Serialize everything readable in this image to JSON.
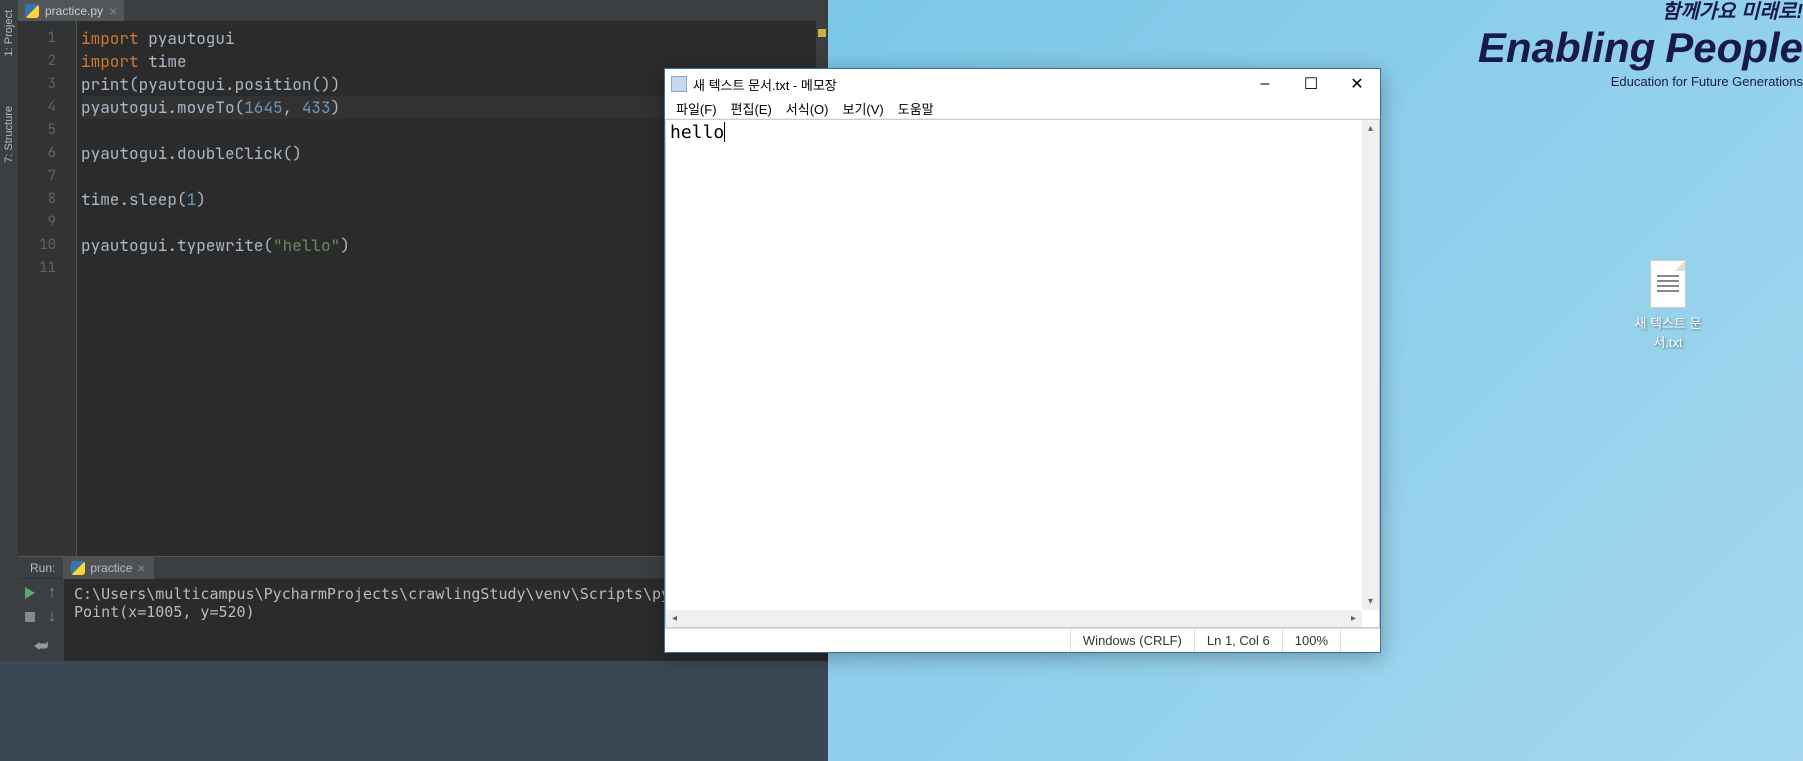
{
  "ide": {
    "sidebar": {
      "tab1": "1: Project",
      "tab2": "7: Structure"
    },
    "tab_name": "practice.py",
    "line_numbers": [
      "1",
      "2",
      "3",
      "4",
      "5",
      "6",
      "7",
      "8",
      "9",
      "10",
      "11"
    ],
    "code": {
      "l1": {
        "kw": "import ",
        "id": "pyautogui"
      },
      "l2": {
        "kw": "import ",
        "id": "time"
      },
      "l3": {
        "a": "print",
        "b": "(pyautogui.position())"
      },
      "l4": {
        "a": "pyautogui.moveTo(",
        "n1": "1645",
        "c": ", ",
        "n2": "433",
        "d": ")"
      },
      "l6": "pyautogui.doubleClick()",
      "l8": {
        "a": "time.sleep(",
        "n": "1",
        "b": ")"
      },
      "l10": {
        "a": "pyautogui.typewrite(",
        "s": "\"hello\"",
        "b": ")"
      }
    },
    "run": {
      "label": "Run:",
      "tab": "practice",
      "out1": "C:\\Users\\multicampus\\PycharmProjects\\crawlingStudy\\venv\\Scripts\\py",
      "out2": "Point(x=1005, y=520)"
    }
  },
  "desktop": {
    "slogan_kr": "함께가요 미래로!",
    "slogan_en_a": "Enabling",
    "slogan_en_b": "People",
    "subtext": "Education for Future Generations",
    "file_label": "새 텍스트\n문서.txt"
  },
  "notepad": {
    "title": "새 텍스트 문서.txt - 메모장",
    "menus": {
      "file": "파일(F)",
      "edit": "편집(E)",
      "format": "서식(O)",
      "view": "보기(V)",
      "help": "도움말"
    },
    "content": "hello",
    "status": {
      "encoding_label": "",
      "crlf": "Windows (CRLF)",
      "pos": "Ln 1, Col 6",
      "zoom": "100%"
    }
  }
}
